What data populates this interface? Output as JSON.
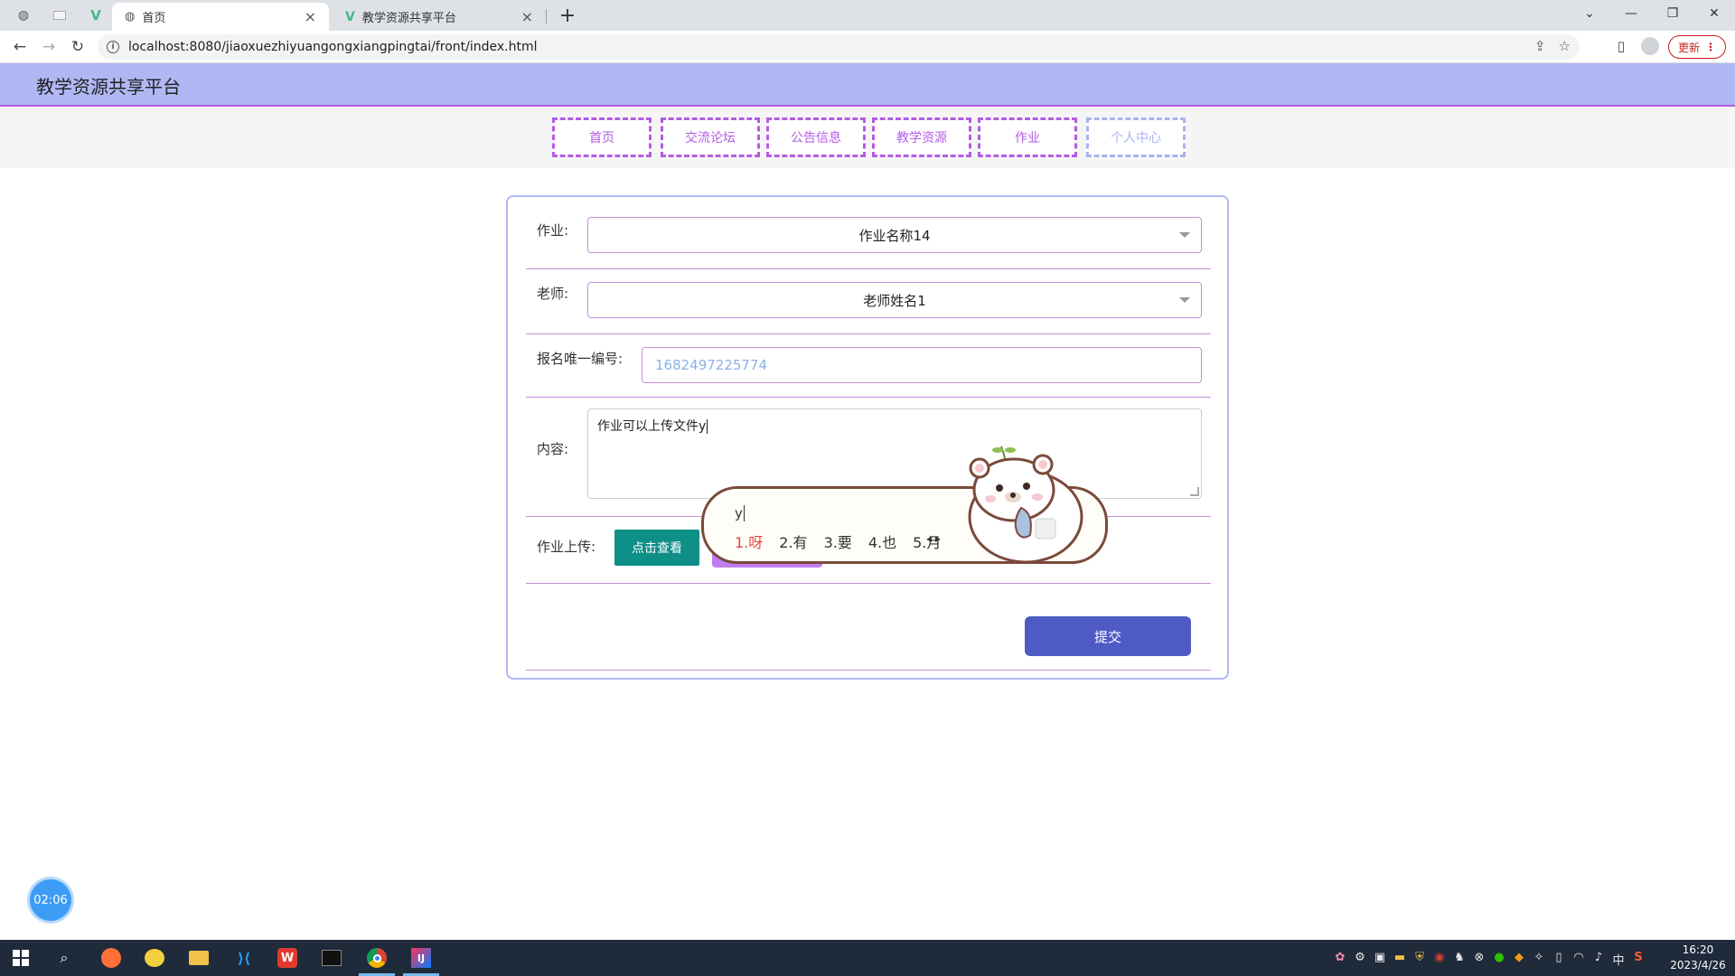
{
  "browser": {
    "tabs": [
      {
        "title": "首页",
        "active": true
      },
      {
        "title": "教学资源共享平台",
        "active": false
      }
    ],
    "close_glyph": "×",
    "new_tab_glyph": "+",
    "url": "localhost:8080/jiaoxuezhiyuangongxiangpingtai/front/index.html",
    "update_label": "更新"
  },
  "site": {
    "title": "教学资源共享平台",
    "nav": [
      {
        "label": "首页"
      },
      {
        "label": "交流论坛"
      },
      {
        "label": "公告信息"
      },
      {
        "label": "教学资源"
      },
      {
        "label": "作业"
      },
      {
        "label": "个人中心"
      }
    ]
  },
  "form": {
    "homework_label": "作业:",
    "homework_value": "作业名称14",
    "teacher_label": "老师:",
    "teacher_value": "老师姓名1",
    "regno_label": "报名唯一编号:",
    "regno_value": "1682497225774",
    "content_label": "内容:",
    "content_value": "作业可以上传文件y",
    "upload_label": "作业上传:",
    "view_button": "点击查看",
    "submit_button": "提交"
  },
  "ime": {
    "composition": "y",
    "candidates": [
      "1.呀",
      "2.有",
      "3.要",
      "4.也",
      "5.月"
    ]
  },
  "timer": "02:06",
  "clock": {
    "time": "16:20",
    "date": "2023/4/26"
  },
  "tray": {
    "ime_mode": "中"
  },
  "colors": {
    "header_bg": "#b0b8f4",
    "accent_purple": "#b45be6",
    "submit_blue": "#4f5bc4",
    "view_teal": "#0e8f87"
  }
}
